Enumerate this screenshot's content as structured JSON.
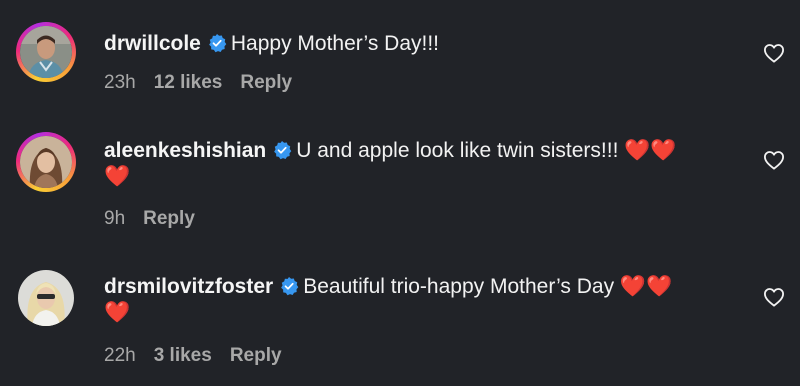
{
  "comments": [
    {
      "username": "drwillcole",
      "text": "Happy Mother’s Day!!!",
      "emoji_line2": "",
      "time": "23h",
      "likes": "12 likes",
      "reply_label": "Reply"
    },
    {
      "username": "aleenkeshishian",
      "text": "U and apple look like twin sisters!!! ❤️❤️",
      "emoji_line2": "❤️",
      "time": "9h",
      "likes": "",
      "reply_label": "Reply"
    },
    {
      "username": "drsmilovitzfoster",
      "text": "Beautiful trio-happy Mother’s Day ❤️❤️",
      "emoji_line2": "❤️",
      "time": "22h",
      "likes": "3 likes",
      "reply_label": "Reply"
    }
  ],
  "colors": {
    "background": "#212328",
    "text": "#f2f2f2",
    "meta": "#a8a8a8",
    "verified": "#3797f0",
    "heart": "#e0102a"
  },
  "icons": [
    "verified-badge-icon",
    "heart-outline-icon"
  ]
}
